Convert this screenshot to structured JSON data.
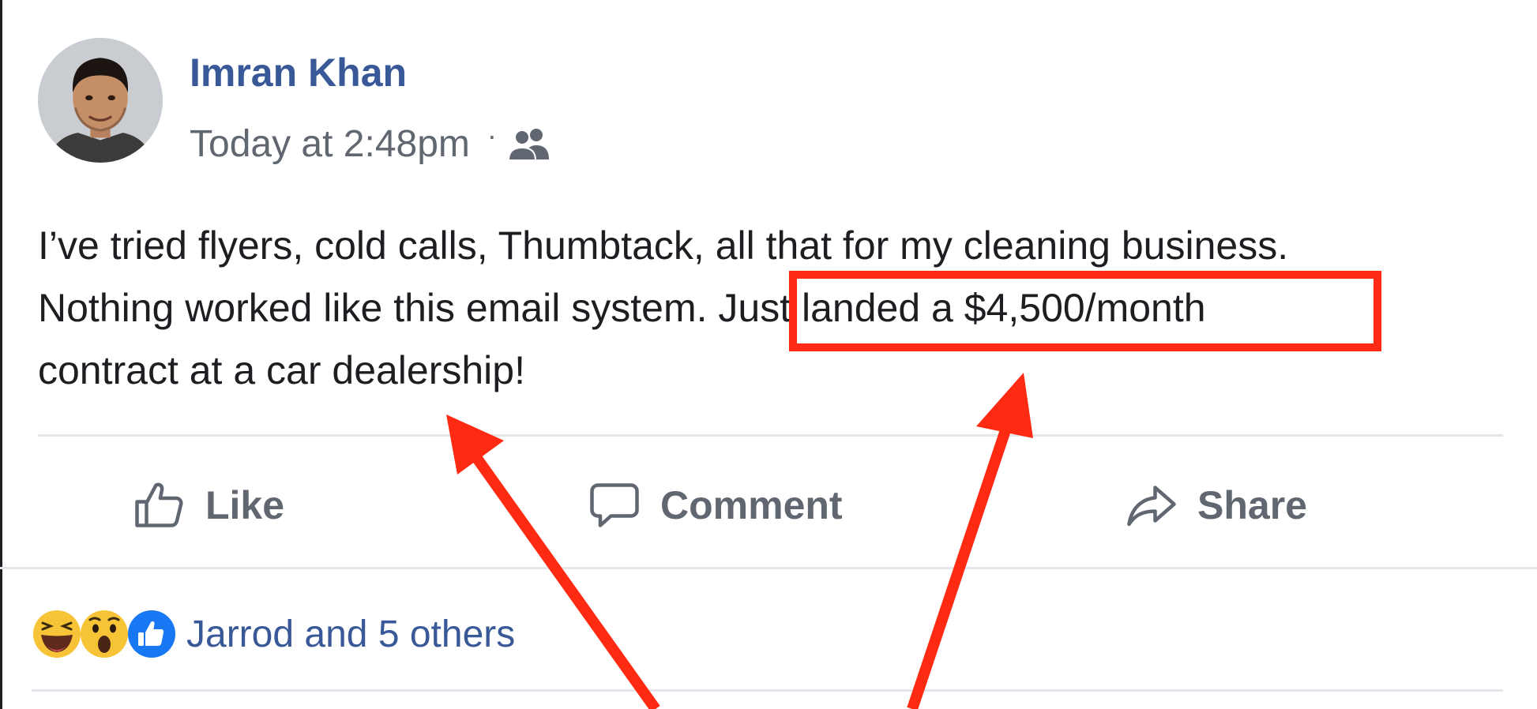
{
  "post": {
    "author": "Imran Khan",
    "timestamp": "Today at 2:48pm",
    "separator": "·",
    "audience_icon": "friends-icon",
    "text_lines": [
      "I’ve tried flyers, cold calls, Thumbtack, all that for my cleaning business.",
      "Nothing worked like this email system. Just landed a $4,500/month",
      "contract at a car dealership!"
    ]
  },
  "actions": {
    "like_label": "Like",
    "comment_label": "Comment",
    "share_label": "Share"
  },
  "reactions": {
    "icons": [
      "laughing-face-icon",
      "surprised-face-icon",
      "thumbs-up-icon"
    ],
    "summary": "Jarrod and 5 others"
  },
  "colors": {
    "name_link": "#385898",
    "secondary_text": "#606770",
    "annotation_red": "#ff2a12",
    "like_blue": "#1877f2",
    "emoji_yellow": "#f7c337"
  }
}
